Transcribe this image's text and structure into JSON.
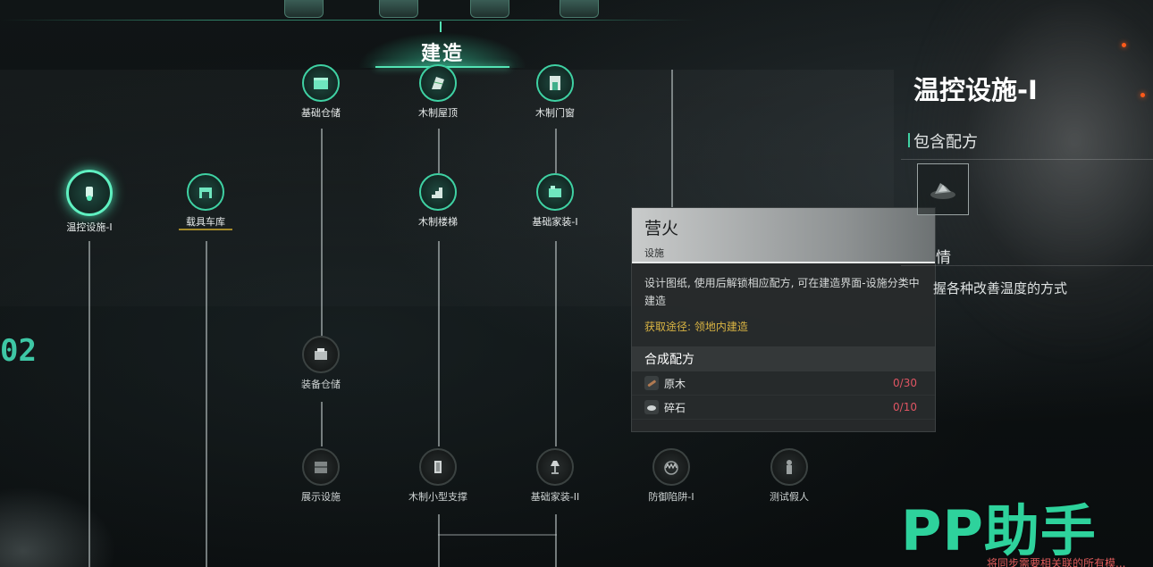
{
  "header": {
    "build_tab": "建造"
  },
  "tier_label": "02",
  "nodes": {
    "basic_storage": "基础仓储",
    "wood_roof": "木制屋顶",
    "wood_door_window": "木制门窗",
    "temp_control": "温控设施-I",
    "vehicle_garage": "载具车库",
    "wood_stairs": "木制楼梯",
    "basic_furnishing_1": "基础家装-I",
    "equipment_storage": "装备仓储",
    "display_facility": "展示设施",
    "wood_small_support": "木制小型支撑",
    "basic_furnishing_2": "基础家装-II",
    "defense_trap": "防御陷阱-I",
    "test_dummy": "测试假人"
  },
  "tooltip": {
    "title": "营火",
    "type": "设施",
    "description": "设计图纸, 使用后解锁相应配方, 可在建造界面-设施分类中建造",
    "source": "获取途径: 领地内建造",
    "recipe_header": "合成配方",
    "materials": [
      {
        "name": "原木",
        "count": "0/30",
        "icon": "log-icon"
      },
      {
        "name": "碎石",
        "count": "0/10",
        "icon": "gravel-icon"
      }
    ]
  },
  "detail_panel": {
    "title": "温控设施-I",
    "contains_label": "包含配方",
    "details_label": "情",
    "description": "握各种改善温度的方式"
  },
  "watermark": "PP助手",
  "footnote": "将同步需要相关联的所有模..."
}
